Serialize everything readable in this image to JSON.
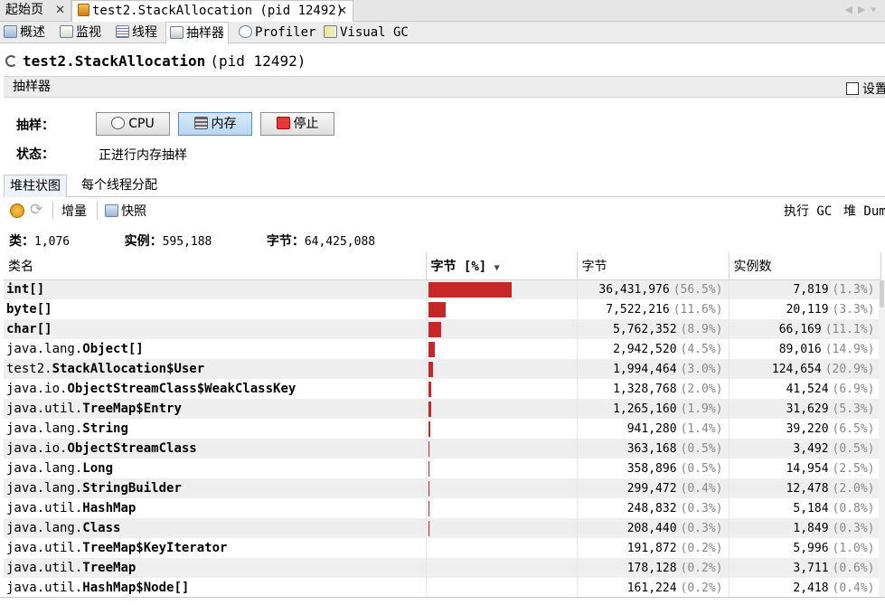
{
  "doc_tabs": [
    {
      "label": "起始页"
    },
    {
      "label": "test2.StackAllocation (pid 12492)"
    }
  ],
  "view_tabs": [
    {
      "label": "概述"
    },
    {
      "label": "监视"
    },
    {
      "label": "线程"
    },
    {
      "label": "抽样器"
    },
    {
      "label": "Profiler"
    },
    {
      "label": "Visual GC"
    }
  ],
  "title": "test2.StackAllocation (pid 12492)",
  "title_main": "test2.StackAllocation",
  "title_pid": "(pid 12492)",
  "section": {
    "label": "抽样器",
    "settings_label": "设置"
  },
  "sample": {
    "label": "抽样：",
    "buttons": [
      {
        "label": "CPU"
      },
      {
        "label": "内存"
      },
      {
        "label": "停止"
      }
    ]
  },
  "status": {
    "label": "状态：",
    "value": "正进行内存抽样"
  },
  "subtabs": [
    {
      "label": "堆柱状图"
    },
    {
      "label": "每个线程分配"
    }
  ],
  "toolbar": {
    "delta_label": "增量",
    "snapshot_label": "快照",
    "gc_label": "执行 GC",
    "heap_dump_label": "堆 Dum"
  },
  "stats": {
    "classes_label": "类：",
    "classes": "1,076",
    "instances_label": "实例：",
    "instances": "595,188",
    "bytes_label": "字节：",
    "bytes": "64,425,088"
  },
  "table": {
    "columns": [
      "类名",
      "字节 [%]",
      "字节",
      "实例数"
    ],
    "rows": [
      {
        "pkg": "",
        "cls": "int[]",
        "pct": 56.5,
        "bytes": "36,431,976",
        "bytes_pct": "(56.5%)",
        "inst": "7,819",
        "inst_pct": "(1.3%)"
      },
      {
        "pkg": "",
        "cls": "byte[]",
        "pct": 11.6,
        "bytes": "7,522,216",
        "bytes_pct": "(11.6%)",
        "inst": "20,119",
        "inst_pct": "(3.3%)"
      },
      {
        "pkg": "",
        "cls": "char[]",
        "pct": 8.9,
        "bytes": "5,762,352",
        "bytes_pct": "(8.9%)",
        "inst": "66,169",
        "inst_pct": "(11.1%)"
      },
      {
        "pkg": "java.lang.",
        "cls": "Object[]",
        "pct": 4.5,
        "bytes": "2,942,520",
        "bytes_pct": "(4.5%)",
        "inst": "89,016",
        "inst_pct": "(14.9%)"
      },
      {
        "pkg": "test2.",
        "cls": "StackAllocation$User",
        "pct": 3.0,
        "bytes": "1,994,464",
        "bytes_pct": "(3.0%)",
        "inst": "124,654",
        "inst_pct": "(20.9%)"
      },
      {
        "pkg": "java.io.",
        "cls": "ObjectStreamClass$WeakClassKey",
        "pct": 2.0,
        "bytes": "1,328,768",
        "bytes_pct": "(2.0%)",
        "inst": "41,524",
        "inst_pct": "(6.9%)"
      },
      {
        "pkg": "java.util.",
        "cls": "TreeMap$Entry",
        "pct": 1.9,
        "bytes": "1,265,160",
        "bytes_pct": "(1.9%)",
        "inst": "31,629",
        "inst_pct": "(5.3%)"
      },
      {
        "pkg": "java.lang.",
        "cls": "String",
        "pct": 1.4,
        "bytes": "941,280",
        "bytes_pct": "(1.4%)",
        "inst": "39,220",
        "inst_pct": "(6.5%)"
      },
      {
        "pkg": "java.io.",
        "cls": "ObjectStreamClass",
        "pct": 0.5,
        "bytes": "363,168",
        "bytes_pct": "(0.5%)",
        "inst": "3,492",
        "inst_pct": "(0.5%)"
      },
      {
        "pkg": "java.lang.",
        "cls": "Long",
        "pct": 0.5,
        "bytes": "358,896",
        "bytes_pct": "(0.5%)",
        "inst": "14,954",
        "inst_pct": "(2.5%)"
      },
      {
        "pkg": "java.lang.",
        "cls": "StringBuilder",
        "pct": 0.4,
        "bytes": "299,472",
        "bytes_pct": "(0.4%)",
        "inst": "12,478",
        "inst_pct": "(2.0%)"
      },
      {
        "pkg": "java.util.",
        "cls": "HashMap",
        "pct": 0.3,
        "bytes": "248,832",
        "bytes_pct": "(0.3%)",
        "inst": "5,184",
        "inst_pct": "(0.8%)"
      },
      {
        "pkg": "java.lang.",
        "cls": "Class",
        "pct": 0.3,
        "bytes": "208,440",
        "bytes_pct": "(0.3%)",
        "inst": "1,849",
        "inst_pct": "(0.3%)"
      },
      {
        "pkg": "java.util.",
        "cls": "TreeMap$KeyIterator",
        "pct": 0.2,
        "bytes": "191,872",
        "bytes_pct": "(0.2%)",
        "inst": "5,996",
        "inst_pct": "(1.0%)"
      },
      {
        "pkg": "java.util.",
        "cls": "TreeMap",
        "pct": 0.2,
        "bytes": "178,128",
        "bytes_pct": "(0.2%)",
        "inst": "3,711",
        "inst_pct": "(0.6%)"
      },
      {
        "pkg": "java.util.",
        "cls": "HashMap$Node[]",
        "pct": 0.2,
        "bytes": "161,224",
        "bytes_pct": "(0.2%)",
        "inst": "2,418",
        "inst_pct": "(0.4%)"
      }
    ]
  },
  "colors": {
    "bar": "#c62828"
  }
}
